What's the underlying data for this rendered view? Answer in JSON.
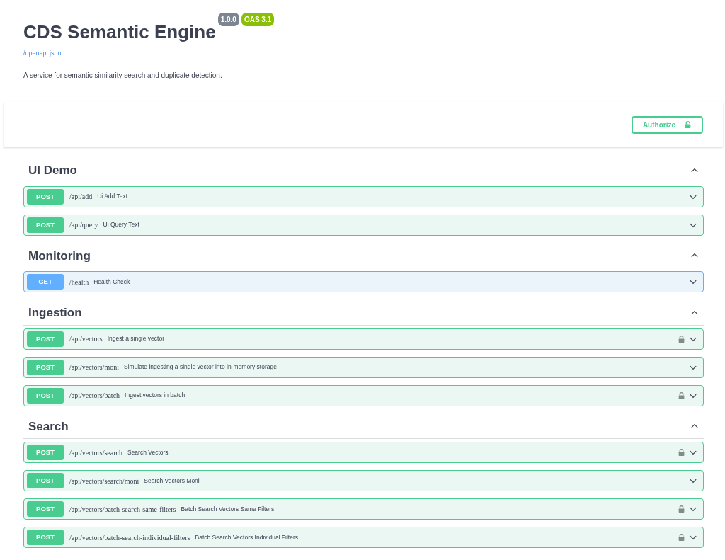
{
  "info": {
    "title": "CDS Semantic Engine",
    "version": "1.0.0",
    "oas": "OAS 3.1",
    "spec_link": "/openapi.json",
    "description": "A service for semantic similarity search and duplicate detection."
  },
  "authorize": {
    "label": "Authorize",
    "locked": false
  },
  "sections": [
    {
      "name": "UI Demo",
      "expanded": true,
      "operations": [
        {
          "method": "POST",
          "path": "/api/add",
          "summary": "Ui Add Text",
          "locked": false
        },
        {
          "method": "POST",
          "path": "/api/query",
          "summary": "Ui Query Text",
          "locked": false
        }
      ]
    },
    {
      "name": "Monitoring",
      "expanded": true,
      "operations": [
        {
          "method": "GET",
          "path": "/health",
          "summary": "Health Check",
          "locked": false
        }
      ]
    },
    {
      "name": "Ingestion",
      "expanded": true,
      "operations": [
        {
          "method": "POST",
          "path": "/api/vectors",
          "summary": "Ingest a single vector",
          "locked": true
        },
        {
          "method": "POST",
          "path": "/api/vectors/moni",
          "summary": "Simulate ingesting a single vector into in-memory storage",
          "locked": false
        },
        {
          "method": "POST",
          "path": "/api/vectors/batch",
          "summary": "Ingest vectors in batch",
          "locked": true
        }
      ]
    },
    {
      "name": "Search",
      "expanded": true,
      "operations": [
        {
          "method": "POST",
          "path": "/api/vectors/search",
          "summary": "Search Vectors",
          "locked": true
        },
        {
          "method": "POST",
          "path": "/api/vectors/search/moni",
          "summary": "Search Vectors Moni",
          "locked": false
        },
        {
          "method": "POST",
          "path": "/api/vectors/batch-search-same-filters",
          "summary": "Batch Search Vectors Same Filters",
          "locked": true
        },
        {
          "method": "POST",
          "path": "/api/vectors/batch-search-individual-filters",
          "summary": "Batch Search Vectors Individual Filters",
          "locked": true
        }
      ]
    }
  ]
}
